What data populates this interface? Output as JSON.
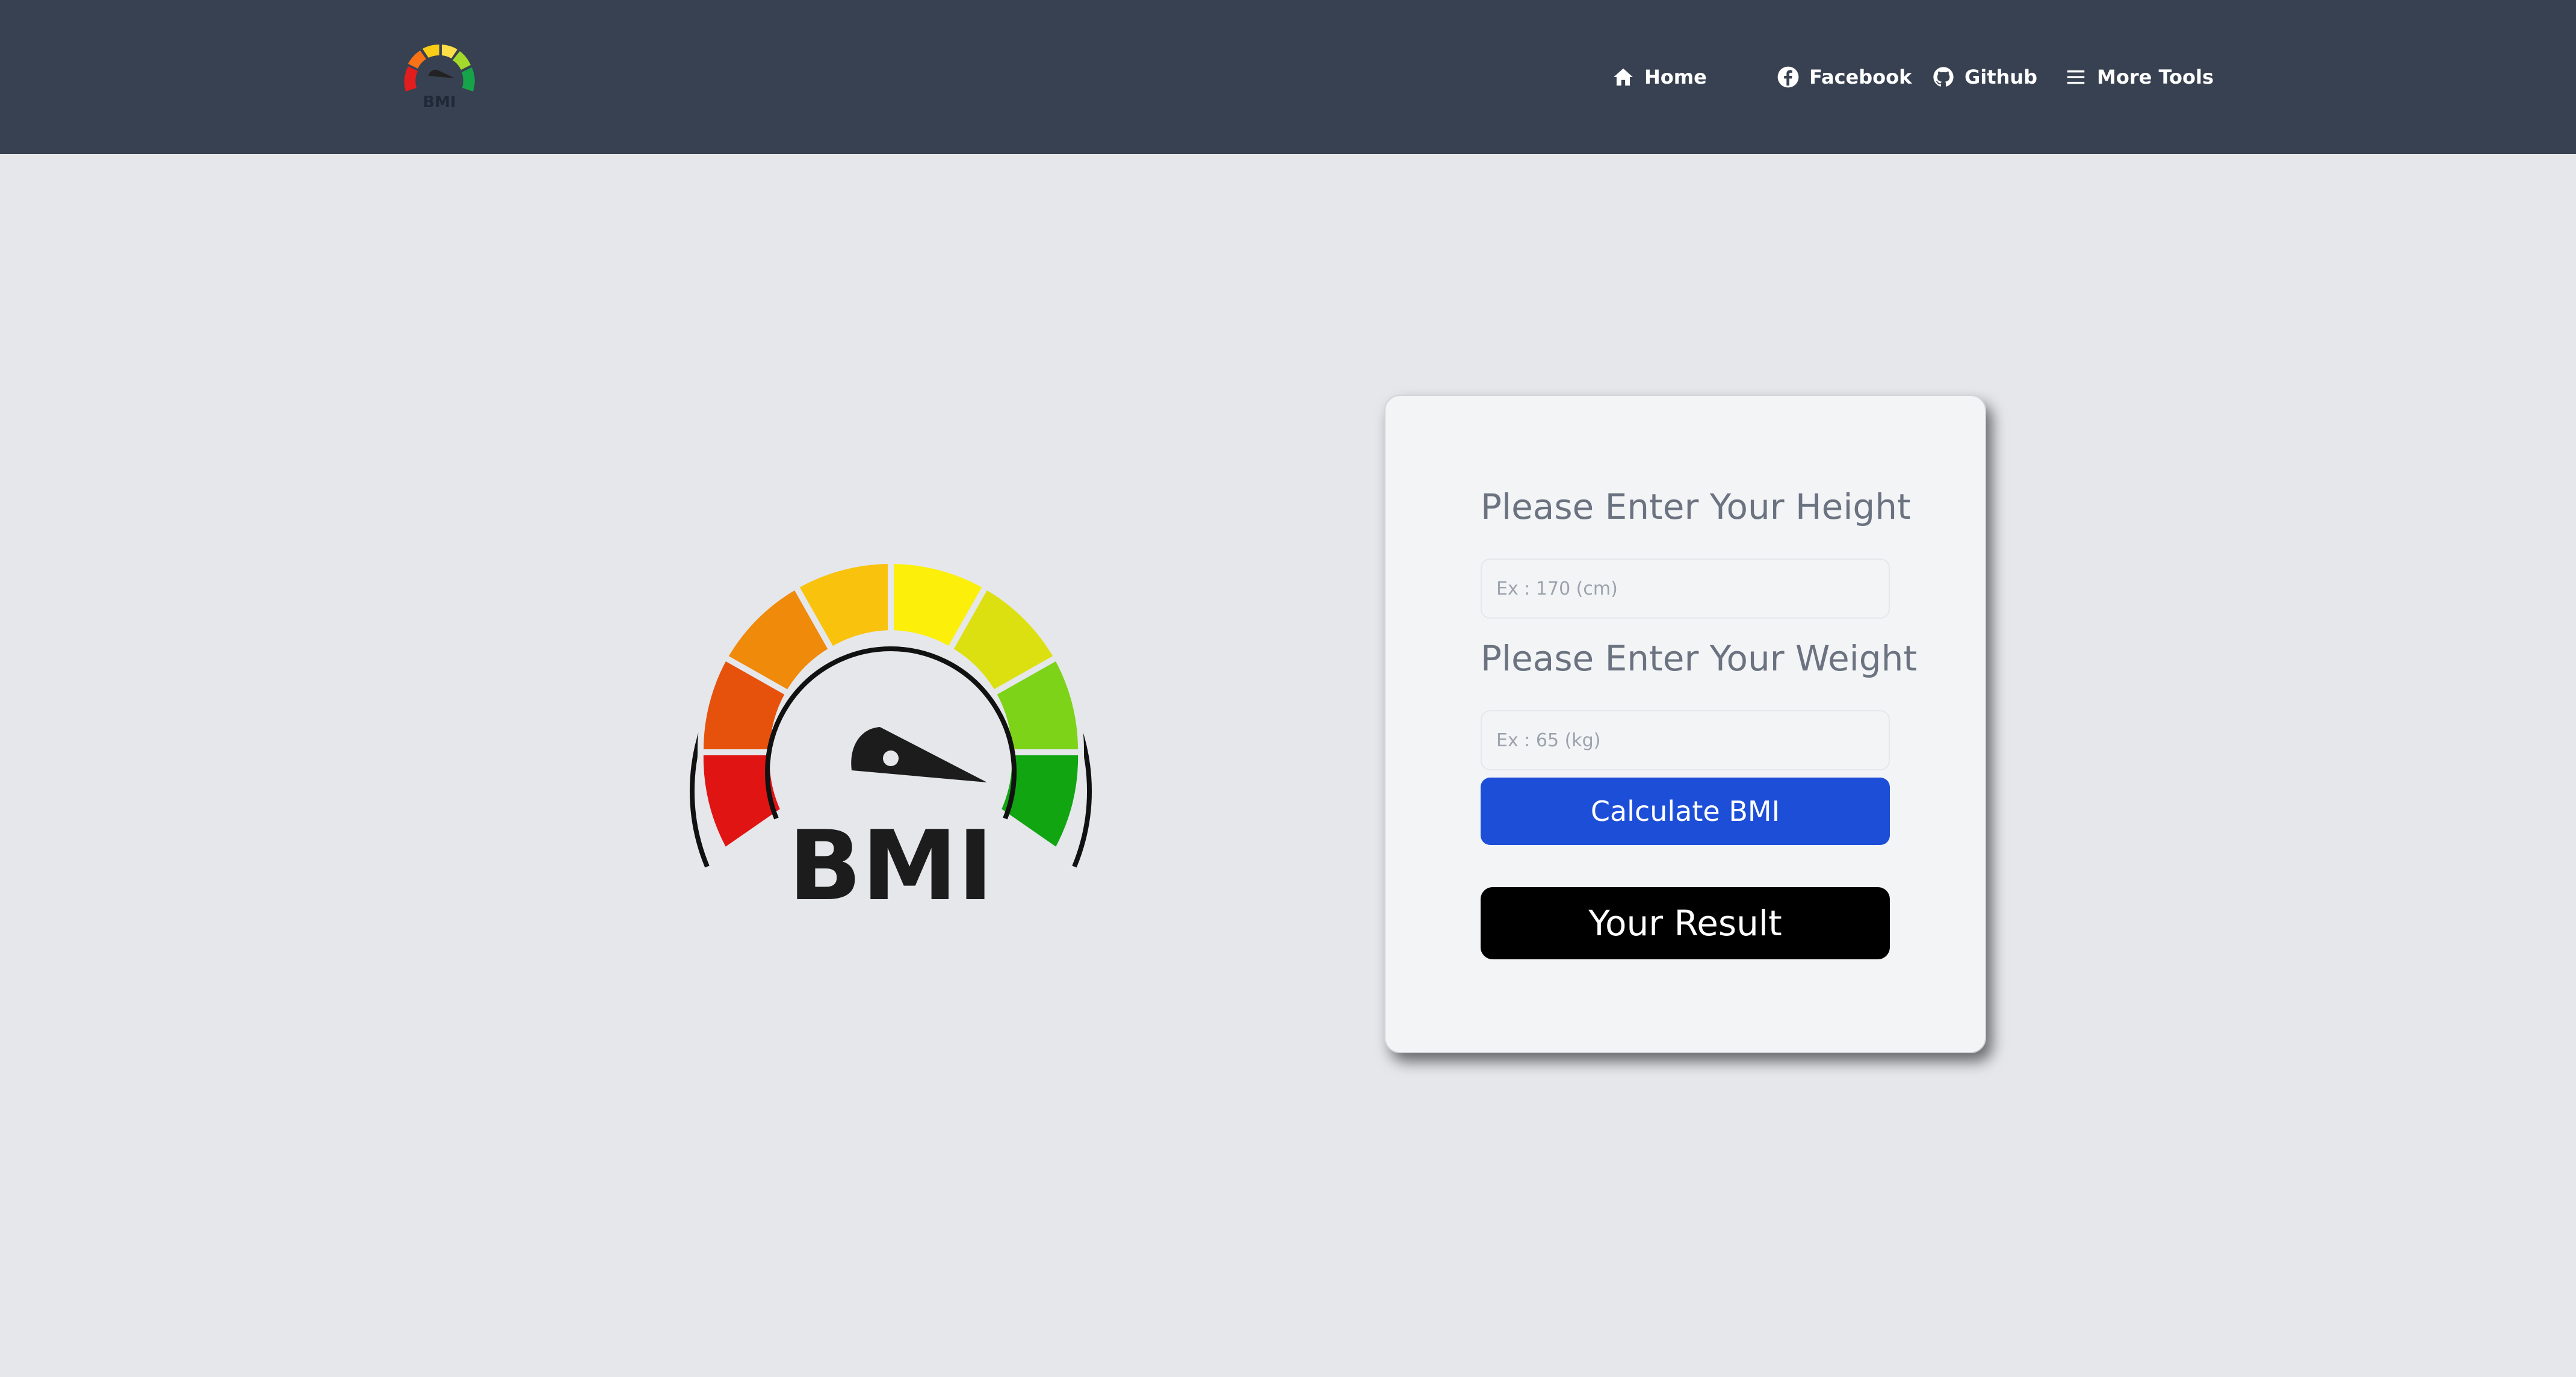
{
  "nav": {
    "logo_text": "BMI",
    "items": [
      {
        "label": "Home",
        "icon": "home-icon"
      },
      {
        "label": "Facebook",
        "icon": "facebook-icon"
      },
      {
        "label": "Github",
        "icon": "github-icon"
      },
      {
        "label": "More Tools",
        "icon": "menu-icon"
      }
    ]
  },
  "illustration": {
    "text": "BMI"
  },
  "form": {
    "height_label": "Please Enter Your Height",
    "height_placeholder": "Ex : 170 (cm)",
    "weight_label": "Please Enter Your Weight",
    "weight_placeholder": "Ex : 65 (kg)",
    "calculate_label": "Calculate BMI",
    "result_label": "Your Result"
  },
  "colors": {
    "header_bg": "#374151",
    "page_bg": "#e5e7eb",
    "card_bg": "#f3f4f6",
    "primary_button": "#1d4ed8",
    "result_bg": "#000000",
    "label_text": "#6b7280"
  }
}
